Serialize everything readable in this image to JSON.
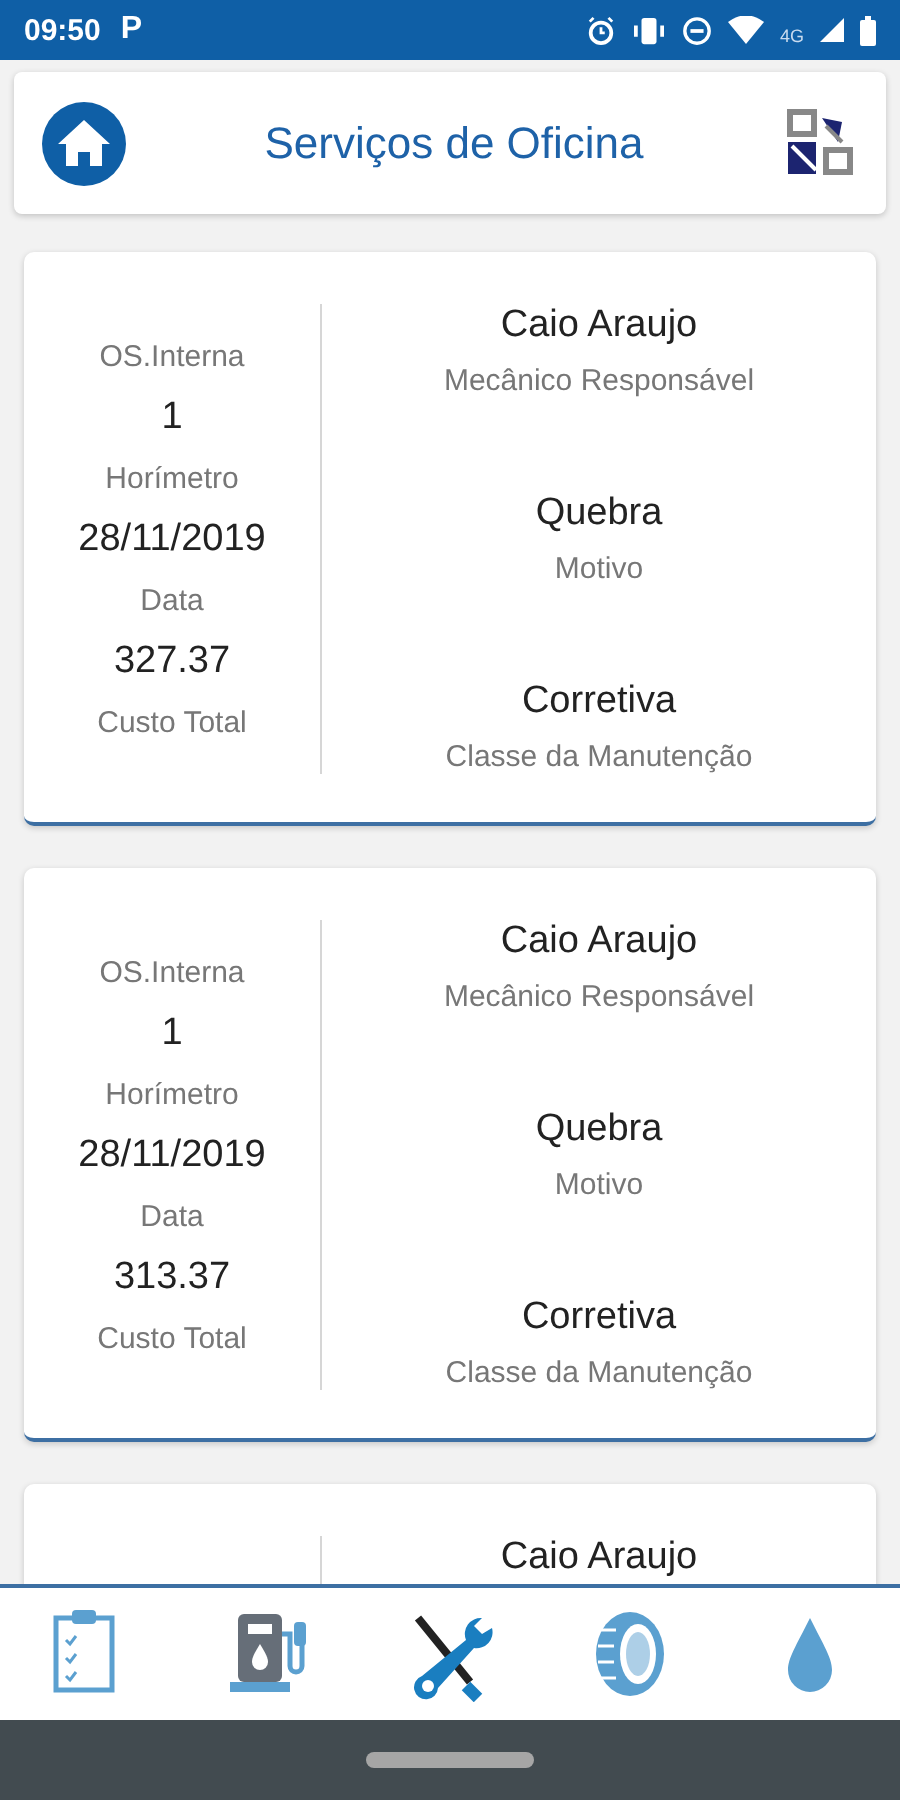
{
  "status_bar": {
    "time": "09:50",
    "notification": "P",
    "network": "4G"
  },
  "header": {
    "title": "Serviços de Oficina"
  },
  "cards": [
    {
      "left": [
        {
          "kind": "label",
          "text": "OS.Interna"
        },
        {
          "kind": "value",
          "text": "1"
        },
        {
          "kind": "label",
          "text": "Horímetro"
        },
        {
          "kind": "value",
          "text": "28/11/2019"
        },
        {
          "kind": "label",
          "text": "Data"
        },
        {
          "kind": "value",
          "text": "327.37"
        },
        {
          "kind": "label",
          "text": "Custo Total"
        }
      ],
      "right": [
        {
          "value": "Caio Araujo",
          "label": "Mecânico Responsável"
        },
        {
          "value": "Quebra",
          "label": "Motivo"
        },
        {
          "value": "Corretiva",
          "label": "Classe da Manutenção"
        }
      ]
    },
    {
      "left": [
        {
          "kind": "label",
          "text": "OS.Interna"
        },
        {
          "kind": "value",
          "text": "1"
        },
        {
          "kind": "label",
          "text": "Horímetro"
        },
        {
          "kind": "value",
          "text": "28/11/2019"
        },
        {
          "kind": "label",
          "text": "Data"
        },
        {
          "kind": "value",
          "text": "313.37"
        },
        {
          "kind": "label",
          "text": "Custo Total"
        }
      ],
      "right": [
        {
          "value": "Caio Araujo",
          "label": "Mecânico Responsável"
        },
        {
          "value": "Quebra",
          "label": "Motivo"
        },
        {
          "value": "Corretiva",
          "label": "Classe da Manutenção"
        }
      ]
    },
    {
      "right": [
        {
          "value": "Caio Araujo"
        }
      ]
    }
  ],
  "bottom_nav": [
    {
      "kind": "checklist",
      "selected": false
    },
    {
      "kind": "fuel",
      "selected": false
    },
    {
      "kind": "tools",
      "selected": true
    },
    {
      "kind": "tire",
      "selected": false
    },
    {
      "kind": "drop",
      "selected": false
    }
  ]
}
